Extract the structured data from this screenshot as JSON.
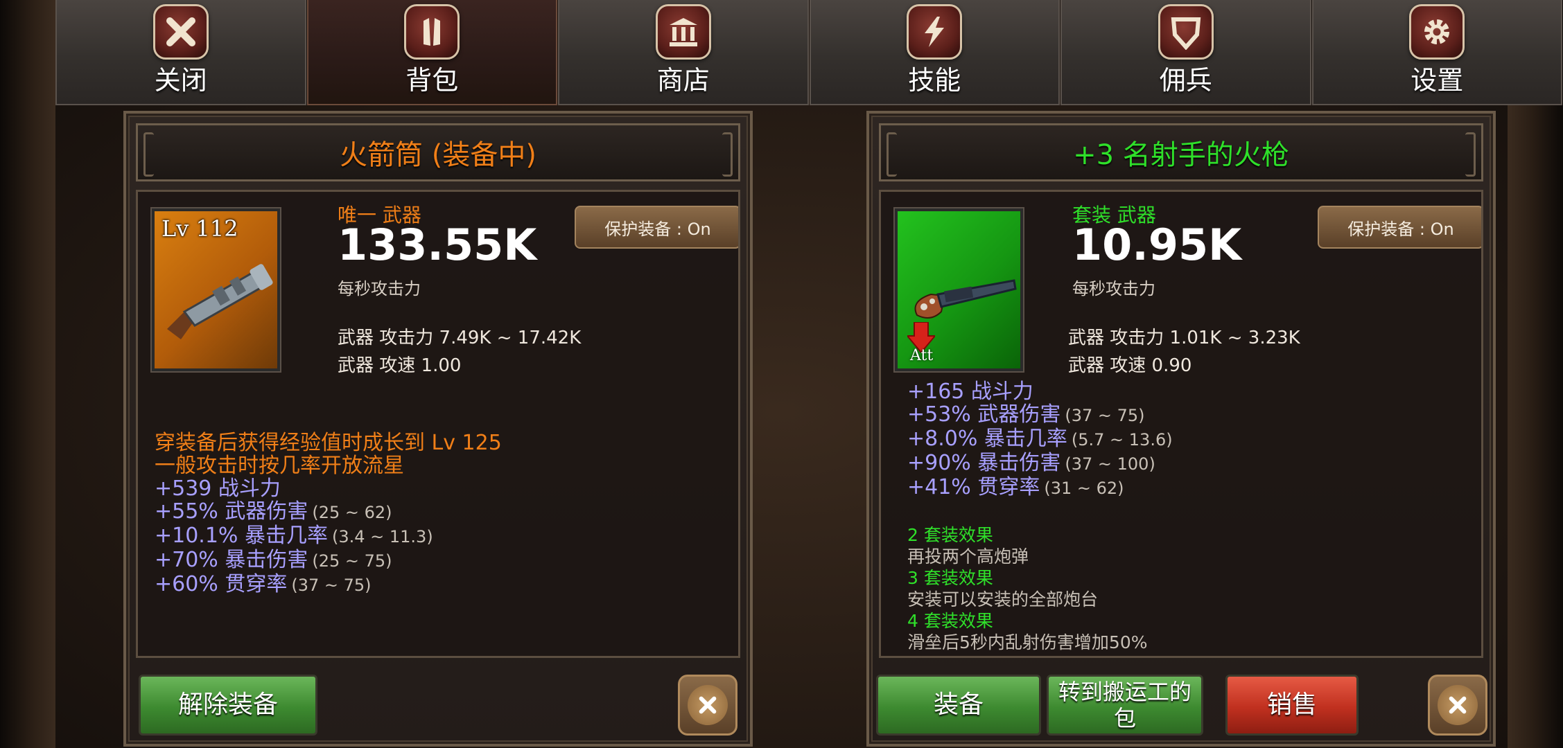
{
  "tabs": [
    {
      "label": "关闭",
      "icon": "close-icon"
    },
    {
      "label": "背包",
      "icon": "backpack-icon"
    },
    {
      "label": "商店",
      "icon": "shop-icon"
    },
    {
      "label": "技能",
      "icon": "lightning-icon"
    },
    {
      "label": "佣兵",
      "icon": "shield-icon"
    },
    {
      "label": "设置",
      "icon": "gear-icon"
    }
  ],
  "colors": {
    "unique": "#f07f18",
    "set": "#2fe02a",
    "bonus": "#a8a0ff"
  },
  "equipped": {
    "title": "火箭筒 (装备中)",
    "level": "Lv 112",
    "rarity": "唯一 武器",
    "dps": "133.55K",
    "dps_label": "每秒攻击力",
    "attack_line": "武器 攻击力 7.49K ~ 17.42K",
    "speed_line": "武器 攻速 1.00",
    "protect_label": "保护装备 : On",
    "special_lines": [
      "穿装备后获得经验值时成长到 Lv 125",
      "一般攻击时按几率开放流星"
    ],
    "stats": [
      {
        "text": "+539 战斗力",
        "range": ""
      },
      {
        "text": "+55% 武器伤害",
        "range": "(25 ~ 62)"
      },
      {
        "text": "+10.1% 暴击几率",
        "range": "(3.4 ~ 11.3)"
      },
      {
        "text": "+70% 暴击伤害",
        "range": "(25 ~ 75)"
      },
      {
        "text": "+60% 贯穿率",
        "range": "(37 ~ 75)"
      }
    ],
    "unequip_label": "解除装备"
  },
  "candidate": {
    "title": "+3 名射手的火枪",
    "rarity": "套装 武器",
    "dps": "10.95K",
    "dps_label": "每秒攻击力",
    "attack_line": "武器 攻击力 1.01K ~ 3.23K",
    "speed_line": "武器 攻速 0.90",
    "protect_label": "保护装备 : On",
    "compare_label": "Att",
    "stats": [
      {
        "text": "+165 战斗力",
        "range": ""
      },
      {
        "text": "+53% 武器伤害",
        "range": "(37 ~ 75)"
      },
      {
        "text": "+8.0% 暴击几率",
        "range": "(5.7 ~ 13.6)"
      },
      {
        "text": "+90% 暴击伤害",
        "range": "(37 ~ 100)"
      },
      {
        "text": "+41% 贯穿率",
        "range": "(31 ~ 62)"
      }
    ],
    "set_effects": [
      {
        "title": "2 套装效果",
        "desc": "再投两个高炮弹"
      },
      {
        "title": "3 套装效果",
        "desc": "安装可以安装的全部炮台"
      },
      {
        "title": "4 套装效果",
        "desc": "滑垒后5秒内乱射伤害增加50%"
      }
    ],
    "equip_label": "装备",
    "transfer_label": "转到搬运工的包",
    "sell_label": "销售"
  }
}
